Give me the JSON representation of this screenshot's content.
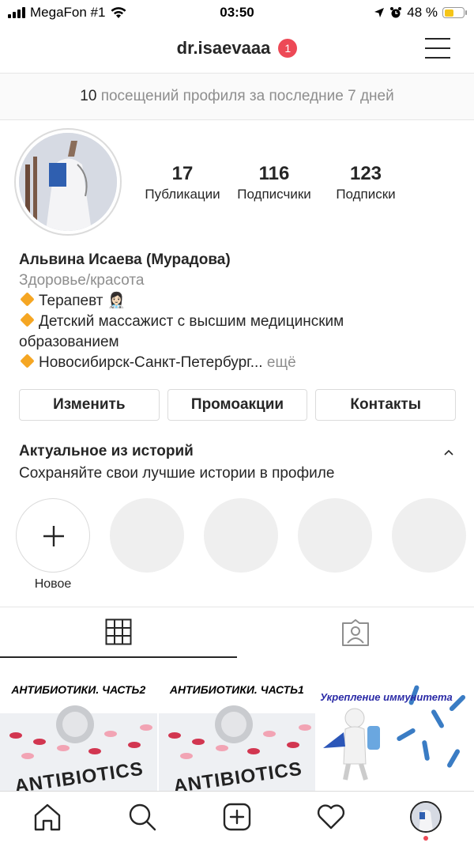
{
  "status_bar": {
    "carrier": "MegaFon #1",
    "time": "03:50",
    "battery": "48 %",
    "battery_level": 0.48
  },
  "header": {
    "username": "dr.isaevaaa",
    "notification_count": "1"
  },
  "visits_banner": {
    "count": "10",
    "text": "посещений профиля за последние 7 дней"
  },
  "stats": [
    {
      "value": "17",
      "label": "Публикации"
    },
    {
      "value": "116",
      "label": "Подписчики"
    },
    {
      "value": "123",
      "label": "Подписки"
    }
  ],
  "bio": {
    "name": "Альвина Исаева (Мурадова)",
    "category": "Здоровье/красота",
    "line1": "Терапевт 👩🏻‍⚕️",
    "line2": "Детский массажист с высшим медицинским",
    "line2b": "образованием",
    "line3": "Новосибирск-Санкт-Петербург...",
    "more": "ещё"
  },
  "buttons": {
    "edit": "Изменить",
    "promotions": "Промоакции",
    "contacts": "Контакты"
  },
  "highlights": {
    "title": "Актуальное из историй",
    "subtitle": "Сохраняйте свои лучшие истории в профиле",
    "new_label": "Новое"
  },
  "posts": [
    {
      "title": "АНТИБИОТИКИ. ЧАСТЬ2",
      "overlay": "ANTIBIOTICS"
    },
    {
      "title": "АНТИБИОТИКИ. ЧАСТЬ1",
      "overlay": "ANTIBIOTICS"
    },
    {
      "title": "Укрепление иммунитета"
    }
  ],
  "icons": {
    "tabs": [
      "grid-icon",
      "tagged-person-icon"
    ],
    "nav": [
      "home-icon",
      "search-icon",
      "new-post-icon",
      "heart-icon",
      "profile-avatar"
    ]
  },
  "colors": {
    "badge": "#ed4956",
    "diamond": "#f5a623",
    "text": "#262626",
    "muted": "#8e8e8e"
  }
}
